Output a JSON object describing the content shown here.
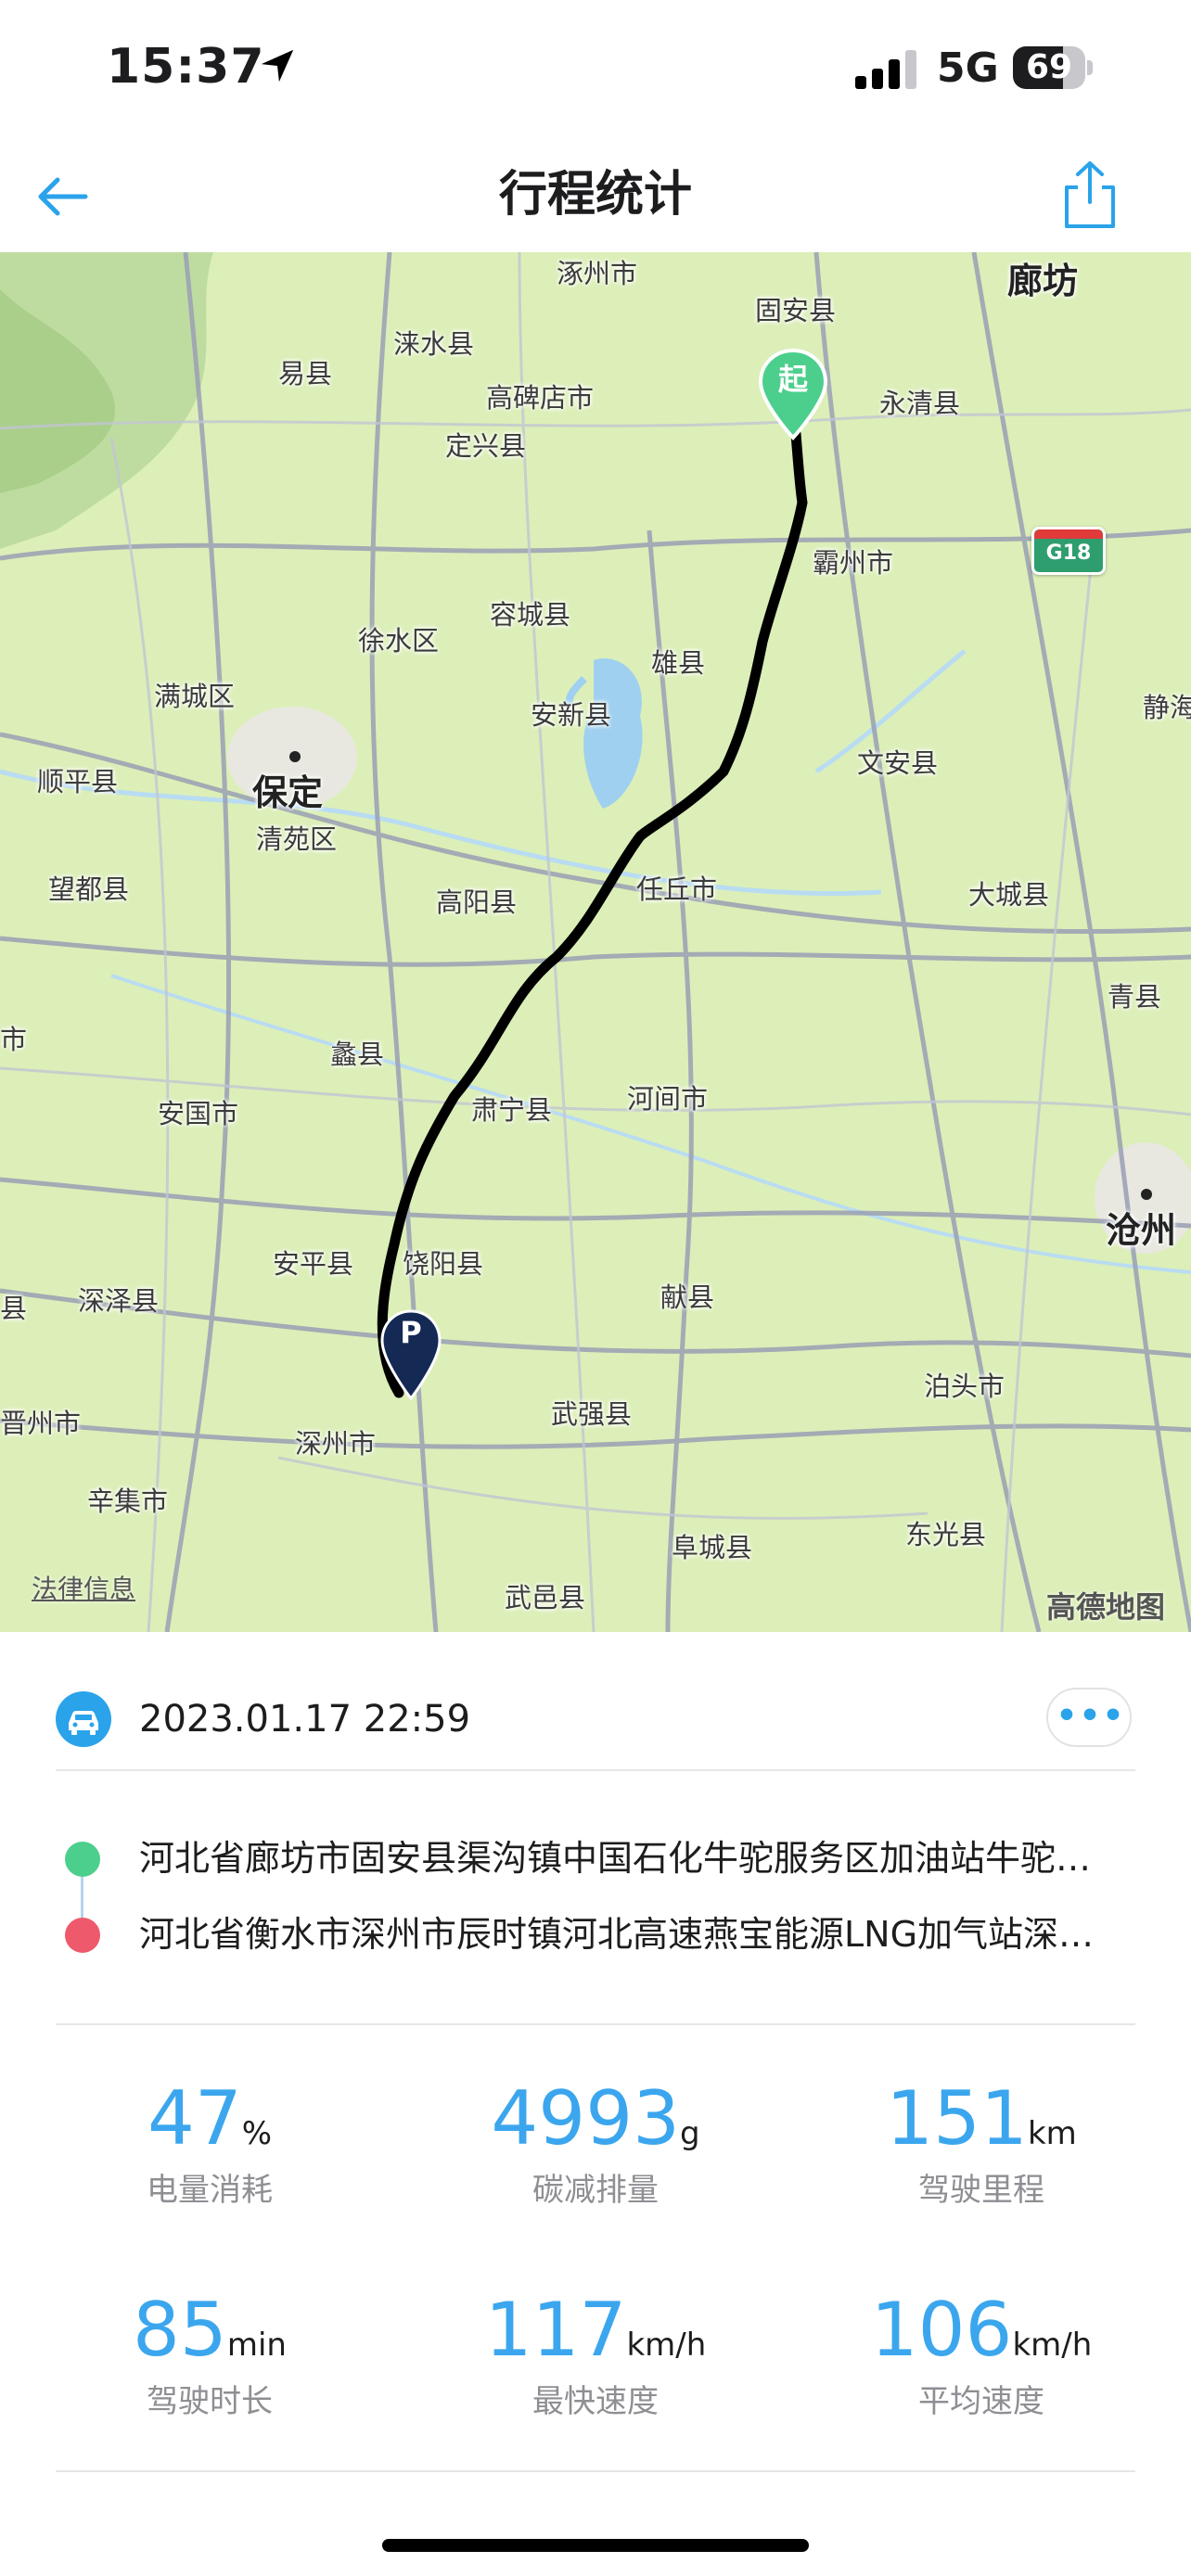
{
  "status_bar": {
    "time": "15:37",
    "network": "5G",
    "battery_level": 69,
    "battery_text": "69"
  },
  "nav": {
    "title": "行程统计",
    "back_icon": "arrow-left-icon",
    "share_icon": "share-icon"
  },
  "map": {
    "labels": {
      "zhuozhou": "涿州市",
      "langfang": "廊坊",
      "guan": "固安县",
      "yixian": "易县",
      "laishui": "涞水县",
      "gaobeidian": "高碑店市",
      "yongqing": "永清县",
      "dingxing": "定兴县",
      "bazhou": "霸州市",
      "rongcheng": "容城县",
      "xushui": "徐水区",
      "xiongxian": "雄县",
      "mancheng": "满城区",
      "anxin": "安新县",
      "jinghai": "静海",
      "shunping": "顺平县",
      "baoding": "保定",
      "qingyuan": "清苑区",
      "wenan": "文安县",
      "wangdu": "望都县",
      "gaoyang": "高阳县",
      "renqiu": "任丘市",
      "dacheng": "大城县",
      "qingxian": "青县",
      "shi": "市",
      "lixian": "蠡县",
      "anguo": "安国市",
      "suning": "肃宁县",
      "hejian": "河间市",
      "cangzhou": "沧州",
      "anping": "安平县",
      "raoyang": "饶阳县",
      "xian": "县",
      "shenze": "深泽县",
      "xianxian": "献县",
      "botou": "泊头市",
      "jinzhou": "晋州市",
      "shenzhou": "深州市",
      "wuqiang": "武强县",
      "xinji": "辛集市",
      "fucheng": "阜城县",
      "dongguang": "东光县",
      "wuyi": "武邑县"
    },
    "highway_shield": "G18",
    "start_marker": "起",
    "end_marker": "P",
    "legal_link": "法律信息",
    "provider_logo": "高德地图"
  },
  "trip": {
    "datetime": "2023.01.17 22:59",
    "car_icon": "car-icon",
    "more_label": "•••",
    "start_address": "河北省廊坊市固安县渠沟镇中国石化牛驼服务区加油站牛驼…",
    "end_address": "河北省衡水市深州市辰时镇河北高速燕宝能源LNG加气站深…"
  },
  "stats": [
    {
      "value": "47",
      "unit": "%",
      "label": "电量消耗"
    },
    {
      "value": "4993",
      "unit": "g",
      "label": "碳减排量"
    },
    {
      "value": "151",
      "unit": "km",
      "label": "驾驶里程"
    },
    {
      "value": "85",
      "unit": "min",
      "label": "驾驶时长"
    },
    {
      "value": "117",
      "unit": "km/h",
      "label": "最快速度"
    },
    {
      "value": "106",
      "unit": "km/h",
      "label": "平均速度"
    }
  ],
  "colors": {
    "accent": "#3ba6ee",
    "start_green": "#4ccf8c",
    "end_red": "#ee5a6b",
    "end_marker_navy": "#142a55",
    "map_land": "#dcefb8"
  }
}
